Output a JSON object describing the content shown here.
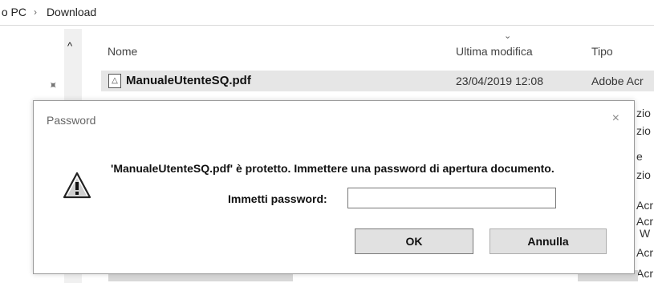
{
  "breadcrumb": {
    "items": [
      "​ PC",
      "Download"
    ],
    "separator": "›"
  },
  "explorer": {
    "columns": {
      "name": "Nome",
      "modified": "Ultima modifica",
      "type": "Tipo"
    },
    "file": {
      "name": "ManualeUtenteSQ.pdf",
      "modified": "23/04/2019 12:08",
      "type": "Adobe Acr"
    },
    "type_fragments": [
      "zio",
      "zio",
      "e",
      "zio",
      "Acr",
      "Acr",
      "W",
      "Acr",
      "Acr"
    ]
  },
  "dialog": {
    "title": "Password",
    "close_glyph": "×",
    "message": "'ManualeUtenteSQ.pdf' è protetto. Immettere una password di apertura documento.",
    "password_label": "Immetti password:",
    "password_value": "",
    "ok_label": "OK",
    "cancel_label": "Annulla"
  },
  "icons": [
    "pin-icon",
    "chevron-up-icon",
    "sort-caret-icon",
    "pdf-file-icon",
    "warning-icon",
    "close-icon"
  ]
}
